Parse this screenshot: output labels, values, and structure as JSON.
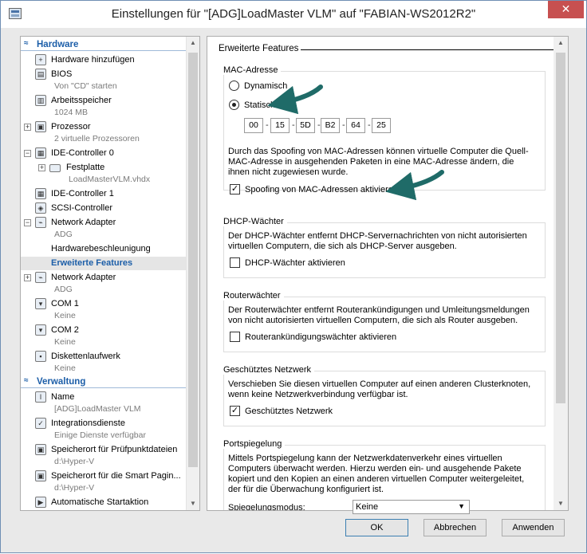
{
  "window": {
    "title": "Einstellungen für \"[ADG]LoadMaster VLM\" auf \"FABIAN-WS2012R2\"",
    "close_glyph": "✕"
  },
  "tree": {
    "sections": {
      "hardware": "Hardware",
      "verwaltung": "Verwaltung"
    },
    "items": [
      {
        "label": "Hardware hinzufügen",
        "icon": "add-hardware-icon"
      },
      {
        "label": "BIOS",
        "sub": "Von \"CD\" starten",
        "icon": "bios-icon"
      },
      {
        "label": "Arbeitsspeicher",
        "sub": "1024 MB",
        "icon": "memory-icon"
      },
      {
        "label": "Prozessor",
        "sub": "2 virtuelle Prozessoren",
        "icon": "processor-icon"
      },
      {
        "label": "IDE-Controller 0",
        "icon": "ide-controller-icon"
      },
      {
        "label": "Festplatte",
        "sub": "LoadMasterVLM.vhdx",
        "icon": "hard-disk-icon"
      },
      {
        "label": "IDE-Controller 1",
        "icon": "ide-controller-icon"
      },
      {
        "label": "SCSI-Controller",
        "icon": "scsi-controller-icon"
      },
      {
        "label": "Network Adapter",
        "sub": "ADG",
        "icon": "network-adapter-icon"
      },
      {
        "label": "Hardwarebeschleunigung"
      },
      {
        "label": "Erweiterte Features"
      },
      {
        "label": "Network Adapter",
        "sub": "ADG",
        "icon": "network-adapter-icon"
      },
      {
        "label": "COM 1",
        "sub": "Keine",
        "icon": "com-port-icon"
      },
      {
        "label": "COM 2",
        "sub": "Keine",
        "icon": "com-port-icon"
      },
      {
        "label": "Diskettenlaufwerk",
        "sub": "Keine",
        "icon": "floppy-icon"
      },
      {
        "label": "Name",
        "sub": "[ADG]LoadMaster VLM",
        "icon": "name-icon"
      },
      {
        "label": "Integrationsdienste",
        "sub": "Einige Dienste verfügbar",
        "icon": "integration-services-icon"
      },
      {
        "label": "Speicherort für Prüfpunktdateien",
        "sub": "d:\\Hyper-V",
        "icon": "checkpoint-icon"
      },
      {
        "label": "Speicherort für die Smart Pagin...",
        "sub": "d:\\Hyper-V",
        "icon": "smart-paging-icon"
      },
      {
        "label": "Automatische Startaktion",
        "icon": "autostart-icon"
      }
    ]
  },
  "panel": {
    "title": "Erweiterte Features",
    "mac": {
      "group_title": "MAC-Adresse",
      "dynamic_label": "Dynamisch",
      "static_label": "Statisch",
      "selected": "static",
      "octets": [
        "00",
        "15",
        "5D",
        "B2",
        "64",
        "25"
      ],
      "separator": "-",
      "description": "Durch das Spoofing von MAC-Adressen können virtuelle Computer die Quell-MAC-Adresse in ausgehenden Paketen in eine MAC-Adresse ändern, die ihnen nicht zugewiesen wurde.",
      "spoof_label": "Spoofing von MAC-Adressen aktivieren",
      "spoof_checked": true
    },
    "dhcp": {
      "group_title": "DHCP-Wächter",
      "description": "Der DHCP-Wächter entfernt DHCP-Servernachrichten von nicht autorisierten virtuellen Computern, die sich als DHCP-Server ausgeben.",
      "check_label": "DHCP-Wächter aktivieren",
      "checked": false
    },
    "router": {
      "group_title": "Routerwächter",
      "description": "Der Routerwächter entfernt Routerankündigungen und Umleitungsmeldungen von nicht autorisierten virtuellen Computern, die sich als Router ausgeben.",
      "check_label": "Routerankündigungswächter aktivieren",
      "checked": false
    },
    "protected": {
      "group_title": "Geschütztes Netzwerk",
      "description": "Verschieben Sie diesen virtuellen Computer auf einen anderen Clusterknoten, wenn keine Netzwerkverbindung verfügbar ist.",
      "check_label": "Geschütztes Netzwerk",
      "checked": true
    },
    "mirroring": {
      "group_title": "Portspiegelung",
      "description": "Mittels Portspiegelung kann der Netzwerkdatenverkehr eines virtuellen Computers überwacht werden. Hierzu werden ein- und ausgehende Pakete kopiert und den Kopien an einen anderen virtuellen Computer weitergeleitet, der für die Überwachung konfiguriert ist.",
      "mode_label": "Spiegelungsmodus:",
      "mode_value": "Keine"
    },
    "check_glyph": "✓"
  },
  "buttons": {
    "ok": "OK",
    "cancel": "Abbrechen",
    "apply": "Anwenden"
  },
  "colors": {
    "accent": "#1c5ea8",
    "close": "#c75050",
    "annotation_arrow": "#1f6b68"
  }
}
